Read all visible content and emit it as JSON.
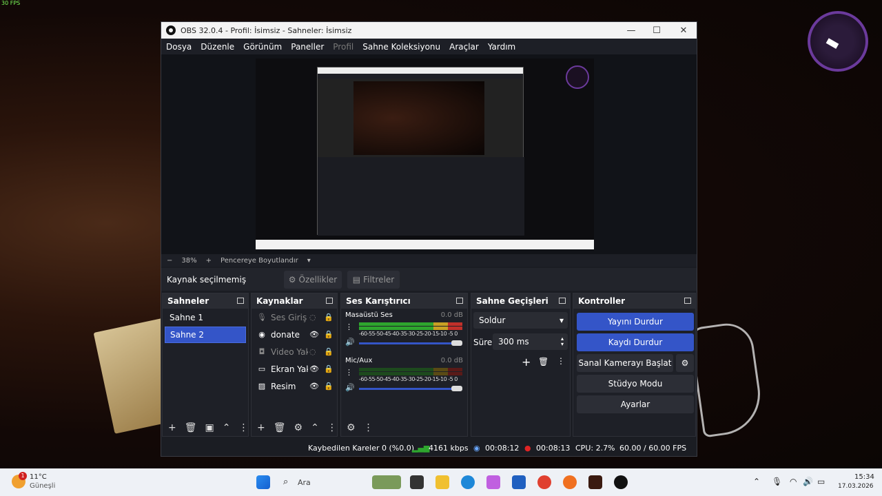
{
  "overlay": {
    "fps": "30 FPS"
  },
  "window": {
    "title": "OBS 32.0.4 - Profil: İsimsiz - Sahneler: İsimsiz",
    "minimize": "—",
    "maximize": "☐",
    "close": "✕"
  },
  "menu": [
    "Dosya",
    "Düzenle",
    "Görünüm",
    "Paneller",
    "Profil",
    "Sahne Koleksiyonu",
    "Araçlar",
    "Yardım"
  ],
  "zoom": {
    "minus": "−",
    "value": "38%",
    "plus": "+",
    "fit": "Pencereye Boyutlandır",
    "arrow": "▾"
  },
  "source_bar": {
    "label": "Kaynak seçilmemiş",
    "properties": "Özellikler",
    "filters": "Filtreler"
  },
  "scenes": {
    "title": "Sahneler",
    "items": [
      "Sahne 1",
      "Sahne 2"
    ],
    "selected": 1
  },
  "sources": {
    "title": "Kaynaklar",
    "items": [
      {
        "name": "Ses Giriş Y",
        "icon": "microphone-icon",
        "active": false
      },
      {
        "name": "donate",
        "icon": "browser-icon",
        "active": true
      },
      {
        "name": "Video Yak",
        "icon": "camera-icon",
        "active": false
      },
      {
        "name": "Ekran Yak",
        "icon": "monitor-icon",
        "active": true
      },
      {
        "name": "Resim",
        "icon": "image-icon",
        "active": true
      }
    ]
  },
  "mixer": {
    "title": "Ses Karıştırıcı",
    "scale": "-60-55-50-45-40-35-30-25-20-15-10 -5  0",
    "channels": [
      {
        "name": "Masaüstü Ses",
        "db": "0.0 dB",
        "level": 1.0
      },
      {
        "name": "Mic/Aux",
        "db": "0.0 dB",
        "level": 0.0
      }
    ]
  },
  "transitions": {
    "title": "Sahne Geçişleri",
    "type": "Soldur",
    "duration_label": "Süre",
    "duration": "300 ms"
  },
  "controls": {
    "title": "Kontroller",
    "stop_stream": "Yayını Durdur",
    "stop_record": "Kaydı Durdur",
    "virtual_cam": "Sanal Kamerayı Başlat",
    "studio": "Stüdyo Modu",
    "settings": "Ayarlar"
  },
  "status": {
    "dropped": "Kaybedilen Kareler 0 (%0.0)",
    "bitrate": "4161 kbps",
    "stream_time": "00:08:12",
    "rec_time": "00:08:13",
    "cpu": "CPU: 2.7%",
    "fps": "60.00 / 60.00 FPS"
  },
  "taskbar": {
    "weather_temp": "11°C",
    "weather_desc": "Güneşli",
    "weather_badge": "1",
    "search": "Ara",
    "time": "15:34",
    "date": "17.03.2026"
  },
  "colors": {
    "accent": "#3455c8",
    "rec": "#e02424",
    "meter_green": "#2ea62e",
    "meter_yellow": "#c8a024",
    "meter_red": "#c0302a"
  }
}
